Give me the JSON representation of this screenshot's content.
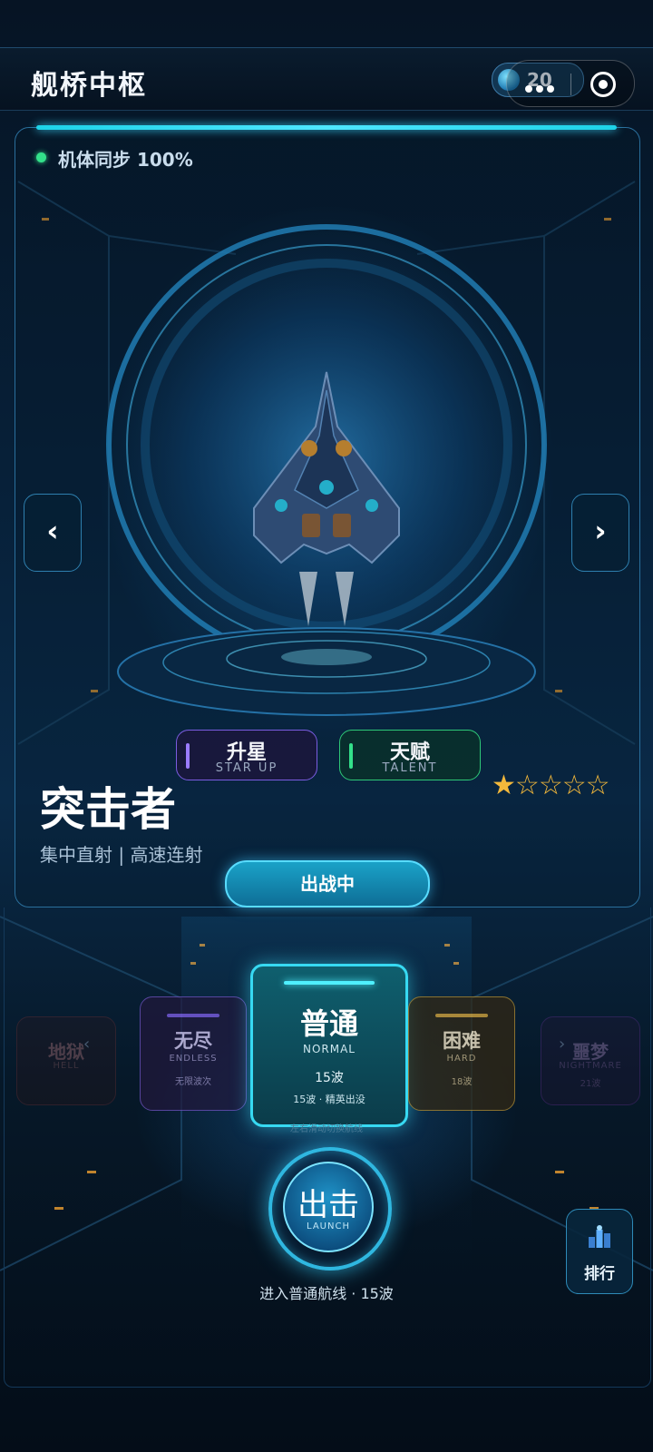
{
  "header": {
    "title": "舰桥中枢",
    "coins": "20"
  },
  "status": {
    "sync_label": "机体同步 100%"
  },
  "ship": {
    "name": "突击者",
    "description": "集中直射 | 高速连射",
    "stars_filled": 1,
    "stars_total": 5,
    "deploy_label": "出战中"
  },
  "actions": {
    "star_up_cn": "升星",
    "star_up_en": "STAR UP",
    "talent_cn": "天赋",
    "talent_en": "TALENT"
  },
  "nav": {
    "prev": "‹",
    "next": "›"
  },
  "modes": [
    {
      "name": "地狱",
      "en": "HELL",
      "waves": ""
    },
    {
      "name": "无尽",
      "en": "ENDLESS",
      "waves": "无限波次"
    },
    {
      "name": "普通",
      "en": "NORMAL",
      "waves": "15波",
      "desc": "15波 · 精英出没"
    },
    {
      "name": "困难",
      "en": "HARD",
      "waves": "18波"
    },
    {
      "name": "噩梦",
      "en": "NIGHTMARE",
      "waves": "21波"
    }
  ],
  "swipe_hint": "左右滑动切换航线",
  "launch": {
    "cn": "出击",
    "en": "LAUNCH",
    "info": "进入普通航线 · 15波"
  },
  "rank": {
    "label": "排行"
  },
  "colors": {
    "accent": "#37d9f2",
    "star": "#f3b83b",
    "online": "#33e08a"
  }
}
